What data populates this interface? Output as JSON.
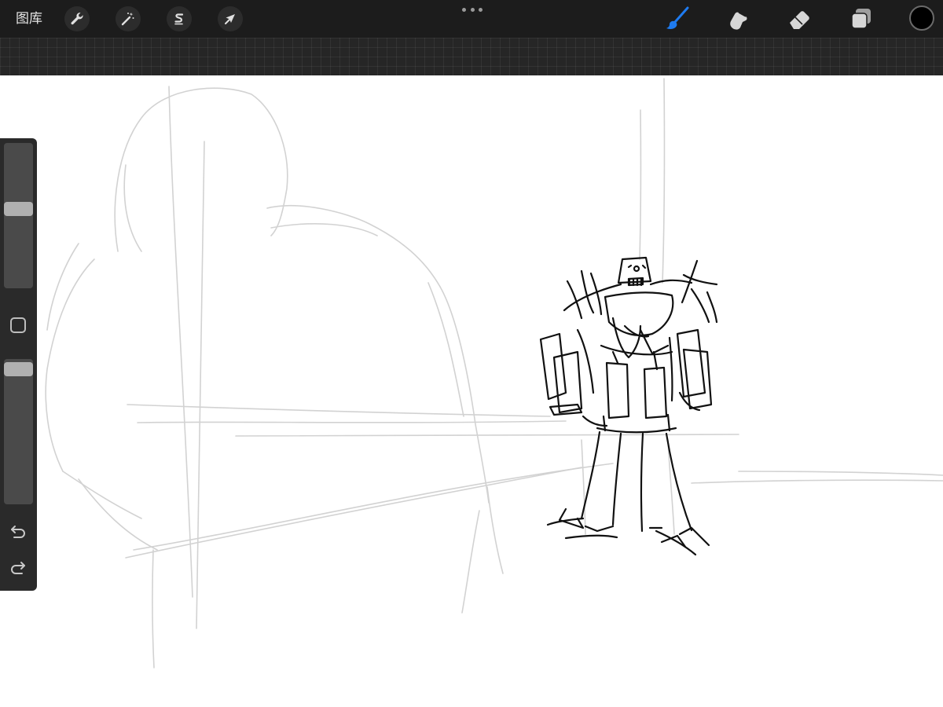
{
  "toolbar": {
    "gallery_label": "图库",
    "left_tools": [
      {
        "name": "actions",
        "icon": "wrench-icon"
      },
      {
        "name": "adjustments",
        "icon": "magic-wand-icon"
      },
      {
        "name": "selection",
        "icon": "s-ribbon-icon"
      },
      {
        "name": "transform",
        "icon": "arrow-cursor-icon"
      }
    ],
    "more_icon": "more-dots-icon",
    "right_tools": [
      {
        "name": "brush",
        "icon": "brush-icon",
        "active": true
      },
      {
        "name": "smudge",
        "icon": "smudge-finger-icon",
        "active": false
      },
      {
        "name": "eraser",
        "icon": "eraser-icon",
        "active": false
      },
      {
        "name": "layers",
        "icon": "layers-icon",
        "active": false
      }
    ],
    "current_color": "#000000"
  },
  "sidebar": {
    "brush_size_level": 0.5,
    "opacity_level": 0.95,
    "modify_icon": "square-outline-icon",
    "undo_icon": "undo-icon",
    "redo_icon": "redo-icon"
  },
  "colors": {
    "toolbar_bg": "#1c1c1c",
    "accent_active": "#1e7bf0",
    "sketch_light": "#cfcfcf",
    "sketch_ink": "#111111"
  }
}
